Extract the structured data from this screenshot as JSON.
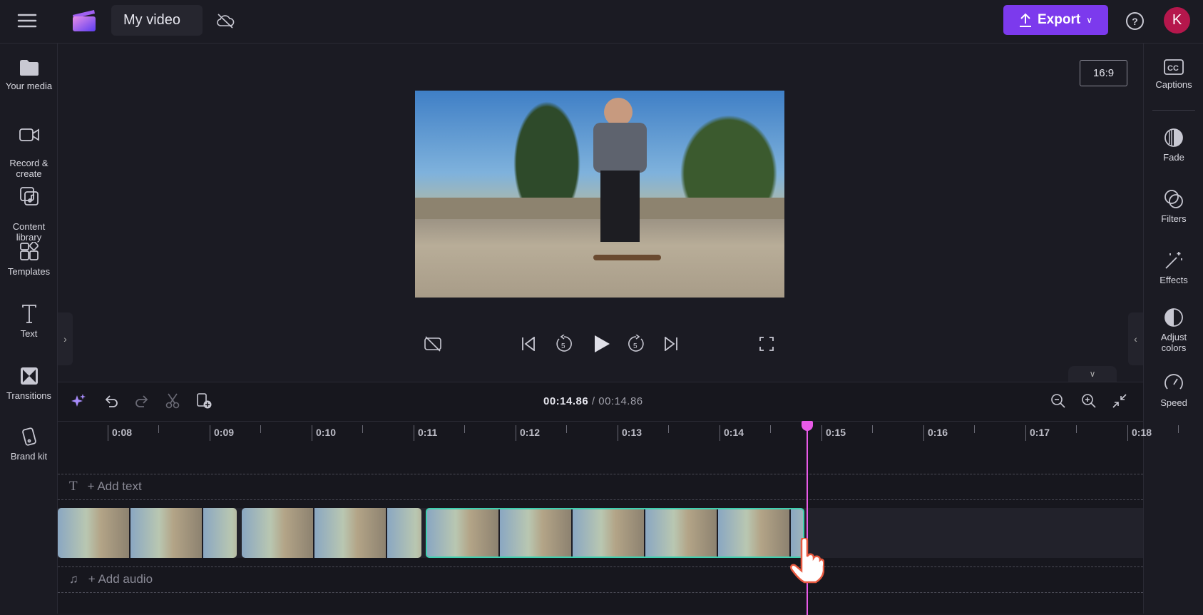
{
  "header": {
    "title": "My video",
    "export_label": "Export",
    "avatar_initial": "K"
  },
  "sidebar": {
    "items": [
      {
        "label": "Your media"
      },
      {
        "label": "Record &\ncreate"
      },
      {
        "label": "Content\nlibrary"
      },
      {
        "label": "Templates"
      },
      {
        "label": "Text"
      },
      {
        "label": "Transitions"
      },
      {
        "label": "Brand kit"
      }
    ]
  },
  "right_panel": {
    "items": [
      {
        "label": "Captions"
      },
      {
        "label": "Fade"
      },
      {
        "label": "Filters"
      },
      {
        "label": "Effects"
      },
      {
        "label": "Adjust\ncolors"
      },
      {
        "label": "Speed"
      }
    ]
  },
  "preview": {
    "aspect_ratio": "16:9"
  },
  "timeline": {
    "current_time": "00:14.86",
    "separator": "/",
    "total_time": "00:14.86",
    "ruler_labels": [
      "0:08",
      "0:09",
      "0:10",
      "0:11",
      "0:12",
      "0:13",
      "0:14",
      "0:15",
      "0:16",
      "0:17",
      "0:18"
    ],
    "add_text": "+ Add text",
    "add_audio": "+ Add audio"
  },
  "colors": {
    "accent": "#7c3aed",
    "playhead": "#e85ae8",
    "selected_clip": "#3fd0b0"
  }
}
